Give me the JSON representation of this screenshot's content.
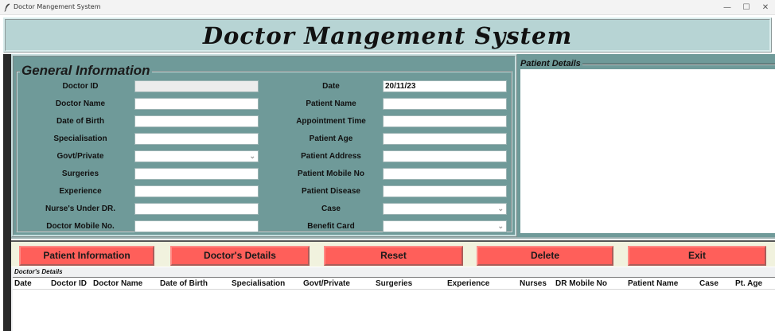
{
  "window": {
    "title": "Doctor Mangement System",
    "controls": {
      "minimize": "—",
      "maximize": "☐",
      "close": "✕"
    }
  },
  "header": {
    "title": "Doctor Mangement System"
  },
  "general_info": {
    "title": "General Information",
    "left_fields": [
      {
        "label": "Doctor ID",
        "value": ""
      },
      {
        "label": "Doctor Name",
        "value": ""
      },
      {
        "label": "Date of Birth",
        "value": ""
      },
      {
        "label": "Specialisation",
        "value": ""
      },
      {
        "label": "Govt/Private",
        "value": ""
      },
      {
        "label": "Surgeries",
        "value": ""
      },
      {
        "label": "Experience",
        "value": ""
      },
      {
        "label": "Nurse's Under DR.",
        "value": ""
      },
      {
        "label": "Doctor Mobile No.",
        "value": ""
      }
    ],
    "right_fields": [
      {
        "label": "Date",
        "value": "20/11/23"
      },
      {
        "label": "Patient Name",
        "value": ""
      },
      {
        "label": "Appointment Time",
        "value": ""
      },
      {
        "label": "Patient Age",
        "value": ""
      },
      {
        "label": "Patient Address",
        "value": ""
      },
      {
        "label": "Patient Mobile No",
        "value": ""
      },
      {
        "label": "Patient Disease",
        "value": ""
      },
      {
        "label": "Case",
        "value": ""
      },
      {
        "label": "Benefit Card",
        "value": ""
      }
    ]
  },
  "patient_details": {
    "title": "Patient Details"
  },
  "buttons": {
    "patient_info": "Patient Information",
    "doctor_details": "Doctor's Details",
    "reset": "Reset",
    "delete": "Delete",
    "exit": "Exit"
  },
  "doctors_details": {
    "title": "Doctor's Details",
    "columns": [
      "Date",
      "Doctor ID",
      "Doctor Name",
      "Date of Birth",
      "Specialisation",
      "Govt/Private",
      "Surgeries",
      "Experience",
      "Nurses",
      "DR Mobile No",
      "Patient Name",
      "Case",
      "Pt. Age"
    ]
  },
  "colors": {
    "frame_teal": "#6f9a99",
    "header_teal": "#b7d4d4",
    "button_red": "#ff5f5a",
    "button_bar": "#f1f2de"
  }
}
